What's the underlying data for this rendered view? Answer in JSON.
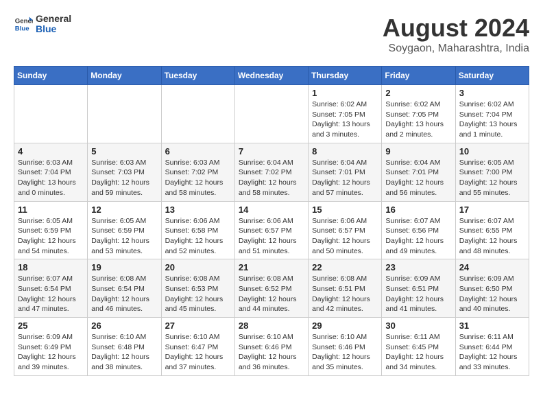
{
  "header": {
    "logo": {
      "line1": "General",
      "line2": "Blue"
    },
    "title": "August 2024",
    "subtitle": "Soygaon, Maharashtra, India"
  },
  "calendar": {
    "headers": [
      "Sunday",
      "Monday",
      "Tuesday",
      "Wednesday",
      "Thursday",
      "Friday",
      "Saturday"
    ],
    "weeks": [
      [
        {
          "date": "",
          "info": ""
        },
        {
          "date": "",
          "info": ""
        },
        {
          "date": "",
          "info": ""
        },
        {
          "date": "",
          "info": ""
        },
        {
          "date": "1",
          "info": "Sunrise: 6:02 AM\nSunset: 7:05 PM\nDaylight: 13 hours\nand 3 minutes."
        },
        {
          "date": "2",
          "info": "Sunrise: 6:02 AM\nSunset: 7:05 PM\nDaylight: 13 hours\nand 2 minutes."
        },
        {
          "date": "3",
          "info": "Sunrise: 6:02 AM\nSunset: 7:04 PM\nDaylight: 13 hours\nand 1 minute."
        }
      ],
      [
        {
          "date": "4",
          "info": "Sunrise: 6:03 AM\nSunset: 7:04 PM\nDaylight: 13 hours\nand 0 minutes."
        },
        {
          "date": "5",
          "info": "Sunrise: 6:03 AM\nSunset: 7:03 PM\nDaylight: 12 hours\nand 59 minutes."
        },
        {
          "date": "6",
          "info": "Sunrise: 6:03 AM\nSunset: 7:02 PM\nDaylight: 12 hours\nand 58 minutes."
        },
        {
          "date": "7",
          "info": "Sunrise: 6:04 AM\nSunset: 7:02 PM\nDaylight: 12 hours\nand 58 minutes."
        },
        {
          "date": "8",
          "info": "Sunrise: 6:04 AM\nSunset: 7:01 PM\nDaylight: 12 hours\nand 57 minutes."
        },
        {
          "date": "9",
          "info": "Sunrise: 6:04 AM\nSunset: 7:01 PM\nDaylight: 12 hours\nand 56 minutes."
        },
        {
          "date": "10",
          "info": "Sunrise: 6:05 AM\nSunset: 7:00 PM\nDaylight: 12 hours\nand 55 minutes."
        }
      ],
      [
        {
          "date": "11",
          "info": "Sunrise: 6:05 AM\nSunset: 6:59 PM\nDaylight: 12 hours\nand 54 minutes."
        },
        {
          "date": "12",
          "info": "Sunrise: 6:05 AM\nSunset: 6:59 PM\nDaylight: 12 hours\nand 53 minutes."
        },
        {
          "date": "13",
          "info": "Sunrise: 6:06 AM\nSunset: 6:58 PM\nDaylight: 12 hours\nand 52 minutes."
        },
        {
          "date": "14",
          "info": "Sunrise: 6:06 AM\nSunset: 6:57 PM\nDaylight: 12 hours\nand 51 minutes."
        },
        {
          "date": "15",
          "info": "Sunrise: 6:06 AM\nSunset: 6:57 PM\nDaylight: 12 hours\nand 50 minutes."
        },
        {
          "date": "16",
          "info": "Sunrise: 6:07 AM\nSunset: 6:56 PM\nDaylight: 12 hours\nand 49 minutes."
        },
        {
          "date": "17",
          "info": "Sunrise: 6:07 AM\nSunset: 6:55 PM\nDaylight: 12 hours\nand 48 minutes."
        }
      ],
      [
        {
          "date": "18",
          "info": "Sunrise: 6:07 AM\nSunset: 6:54 PM\nDaylight: 12 hours\nand 47 minutes."
        },
        {
          "date": "19",
          "info": "Sunrise: 6:08 AM\nSunset: 6:54 PM\nDaylight: 12 hours\nand 46 minutes."
        },
        {
          "date": "20",
          "info": "Sunrise: 6:08 AM\nSunset: 6:53 PM\nDaylight: 12 hours\nand 45 minutes."
        },
        {
          "date": "21",
          "info": "Sunrise: 6:08 AM\nSunset: 6:52 PM\nDaylight: 12 hours\nand 44 minutes."
        },
        {
          "date": "22",
          "info": "Sunrise: 6:08 AM\nSunset: 6:51 PM\nDaylight: 12 hours\nand 42 minutes."
        },
        {
          "date": "23",
          "info": "Sunrise: 6:09 AM\nSunset: 6:51 PM\nDaylight: 12 hours\nand 41 minutes."
        },
        {
          "date": "24",
          "info": "Sunrise: 6:09 AM\nSunset: 6:50 PM\nDaylight: 12 hours\nand 40 minutes."
        }
      ],
      [
        {
          "date": "25",
          "info": "Sunrise: 6:09 AM\nSunset: 6:49 PM\nDaylight: 12 hours\nand 39 minutes."
        },
        {
          "date": "26",
          "info": "Sunrise: 6:10 AM\nSunset: 6:48 PM\nDaylight: 12 hours\nand 38 minutes."
        },
        {
          "date": "27",
          "info": "Sunrise: 6:10 AM\nSunset: 6:47 PM\nDaylight: 12 hours\nand 37 minutes."
        },
        {
          "date": "28",
          "info": "Sunrise: 6:10 AM\nSunset: 6:46 PM\nDaylight: 12 hours\nand 36 minutes."
        },
        {
          "date": "29",
          "info": "Sunrise: 6:10 AM\nSunset: 6:46 PM\nDaylight: 12 hours\nand 35 minutes."
        },
        {
          "date": "30",
          "info": "Sunrise: 6:11 AM\nSunset: 6:45 PM\nDaylight: 12 hours\nand 34 minutes."
        },
        {
          "date": "31",
          "info": "Sunrise: 6:11 AM\nSunset: 6:44 PM\nDaylight: 12 hours\nand 33 minutes."
        }
      ]
    ]
  }
}
